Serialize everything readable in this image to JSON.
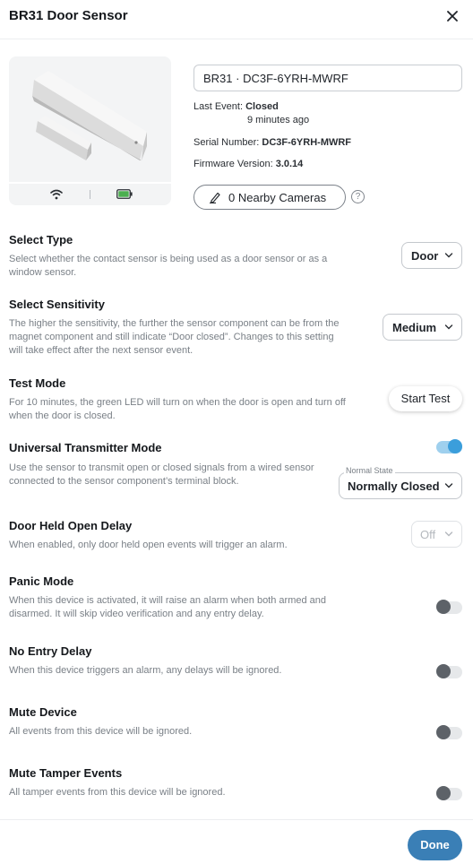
{
  "header": {
    "title": "BR31 Door Sensor"
  },
  "device": {
    "name_value": "BR31 · DC3F-6YRH-MWRF",
    "last_event_label": "Last Event:",
    "last_event_value": "Closed",
    "last_event_time": "9 minutes ago",
    "serial_label": "Serial Number:",
    "serial_value": "DC3F-6YRH-MWRF",
    "firmware_label": "Firmware Version:",
    "firmware_value": "3.0.14",
    "nearby_cameras_label": "0 Nearby Cameras",
    "help_glyph": "?"
  },
  "settings": {
    "select_type": {
      "title": "Select Type",
      "description": "Select whether the contact sensor is being used as a door sensor or as a window sensor.",
      "value": "Door"
    },
    "select_sensitivity": {
      "title": "Select Sensitivity",
      "description": "The higher the sensitivity, the further the sensor component can be from the magnet component and still indicate “Door closed”. Changes to this setting will take effect after the next sensor event.",
      "value": "Medium"
    },
    "test_mode": {
      "title": "Test Mode",
      "description": "For 10 minutes, the green LED will turn on when the door is open and turn off when the door is closed.",
      "button_label": "Start Test"
    },
    "universal_transmitter": {
      "title": "Universal Transmitter Mode",
      "description": "Use the sensor to transmit open or closed signals from a wired sensor connected to the sensor component’s terminal block.",
      "enabled": true,
      "normal_state_label": "Normal State",
      "normal_state_value": "Normally Closed"
    },
    "door_held_open": {
      "title": "Door Held Open Delay",
      "description": "When enabled, only door held open events will trigger an alarm.",
      "value": "Off"
    },
    "panic_mode": {
      "title": "Panic Mode",
      "description": "When this device is activated, it will raise an alarm when both armed and disarmed. It will skip video verification and any entry delay.",
      "enabled": false
    },
    "no_entry_delay": {
      "title": "No Entry Delay",
      "description": "When this device triggers an alarm, any delays will be ignored.",
      "enabled": false
    },
    "mute_device": {
      "title": "Mute Device",
      "description": "All events from this device will be ignored.",
      "enabled": false
    },
    "mute_tamper": {
      "title": "Mute Tamper Events",
      "description": "All tamper events from this device will be ignored.",
      "enabled": false
    }
  },
  "footer": {
    "done_label": "Done"
  },
  "colors": {
    "accent": "#3a7fb6",
    "toggle_on": "#3b9edb",
    "battery": "#4caf50"
  }
}
